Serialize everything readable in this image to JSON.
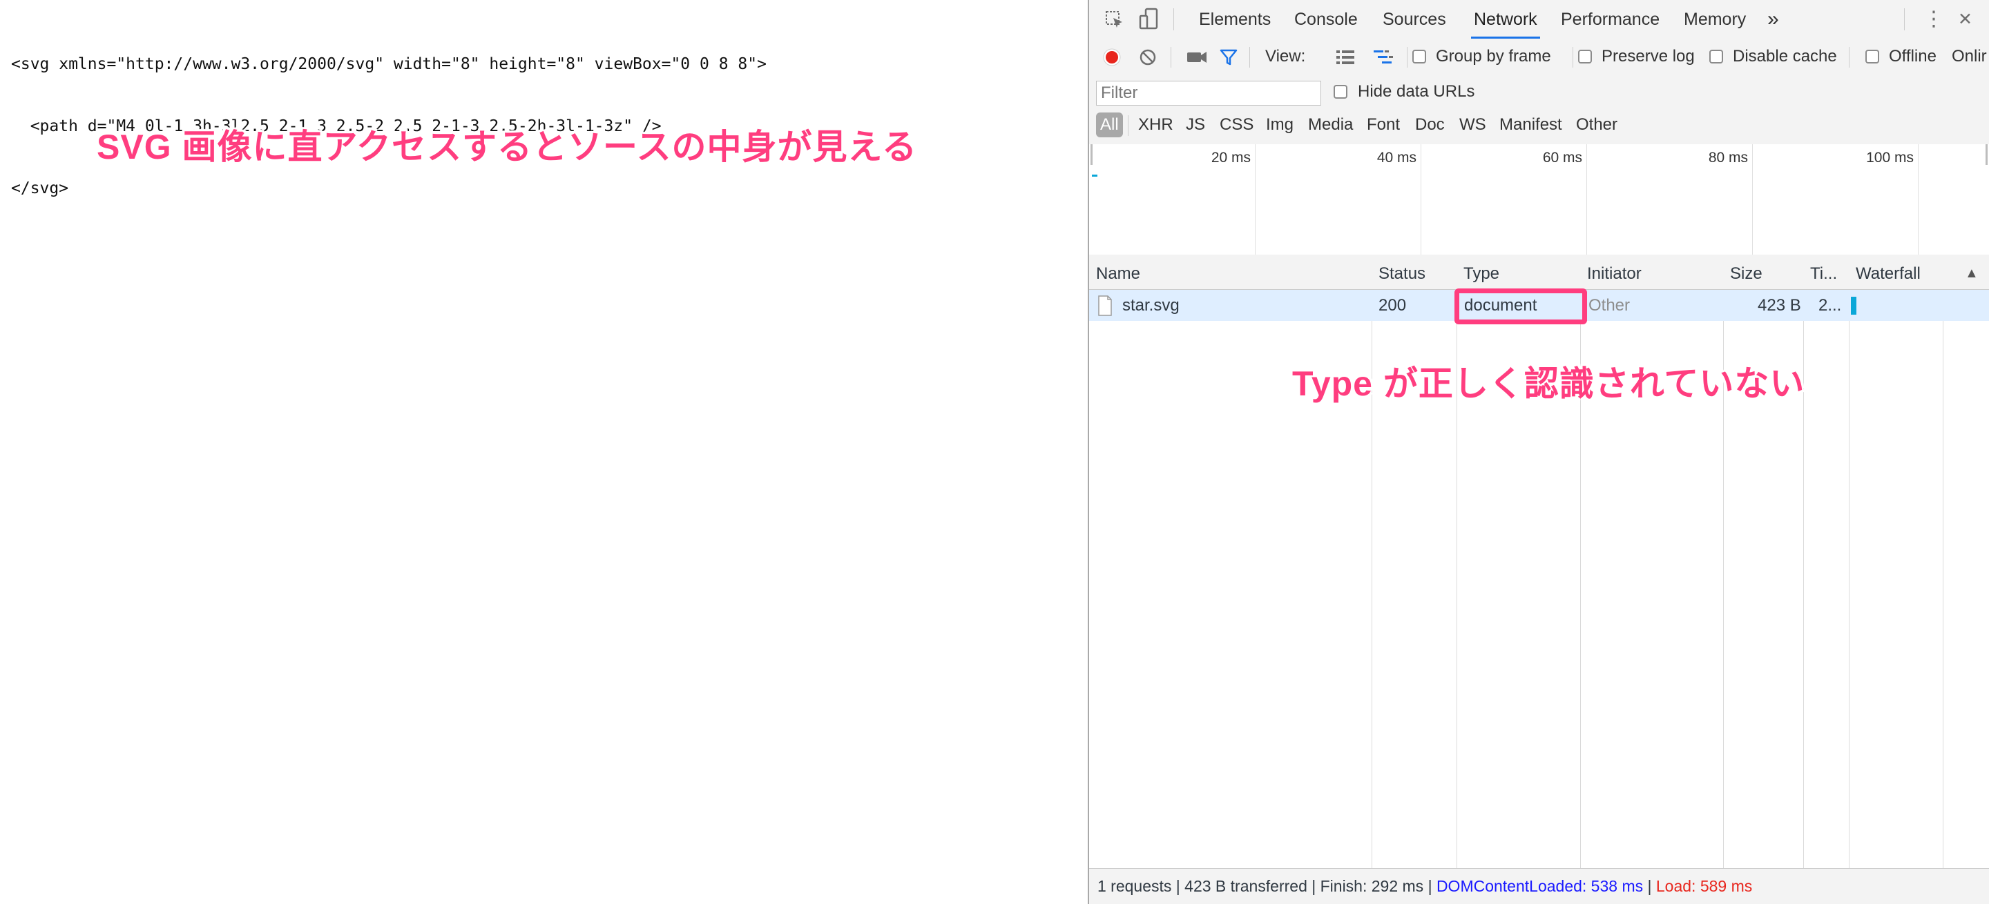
{
  "page": {
    "source_lines": [
      "<svg xmlns=\"http://www.w3.org/2000/svg\" width=\"8\" height=\"8\" viewBox=\"0 0 8 8\">",
      "  <path d=\"M4 0l-1 3h-3l2.5 2-1 3 2.5-2 2.5 2-1-3 2.5-2h-3l-1-3z\" />",
      "</svg>"
    ],
    "annotation_top": "SVG 画像に直アクセスするとソースの中身が見える",
    "annotation_right": "Type が正しく認識されていない",
    "annotation_color": "#ff3d7f"
  },
  "devtools": {
    "tabs": [
      "Elements",
      "Console",
      "Sources",
      "Network",
      "Performance",
      "Memory"
    ],
    "active_tab": "Network",
    "more_tabs_glyph": "»",
    "menu_glyph": "⋮",
    "close_glyph": "✕",
    "toolbar": {
      "view_label": "View:",
      "group_by_frame": "Group by frame",
      "preserve_log": "Preserve log",
      "disable_cache": "Disable cache",
      "offline": "Offline",
      "online_truncated": "Onlir"
    },
    "filter": {
      "placeholder": "Filter",
      "hide_data_urls": "Hide data URLs"
    },
    "type_filters": [
      "All",
      "XHR",
      "JS",
      "CSS",
      "Img",
      "Media",
      "Font",
      "Doc",
      "WS",
      "Manifest",
      "Other"
    ],
    "overview_ticks": [
      "20 ms",
      "40 ms",
      "60 ms",
      "80 ms",
      "100 ms"
    ],
    "columns": [
      "Name",
      "Status",
      "Type",
      "Initiator",
      "Size",
      "Ti...",
      "Waterfall"
    ],
    "sort_glyph": "▲",
    "rows": [
      {
        "name": "star.svg",
        "status": "200",
        "type": "document",
        "initiator": "Other",
        "size": "423 B",
        "time": "2..."
      }
    ],
    "statusbar": {
      "summary": "1 requests | 423 B transferred | Finish: 292 ms | ",
      "dom_content_loaded": "DOMContentLoaded: 538 ms",
      "separator": " | ",
      "load": "Load: 589 ms"
    },
    "colors": {
      "record_red": "#e8261d",
      "accent_blue": "#1a73e8",
      "dcl_blue": "#1a1aff",
      "load_red": "#e8261d",
      "waterfall_bar": "#0aa7d8",
      "row_selected": "#dfeeff"
    }
  }
}
